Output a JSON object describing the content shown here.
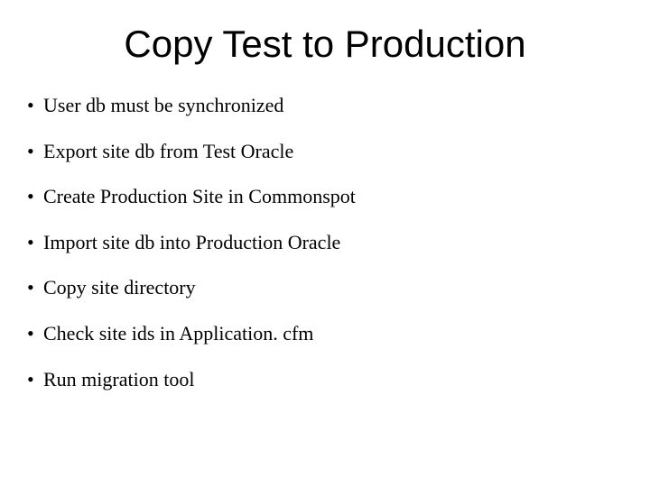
{
  "title": "Copy Test to Production",
  "bullets": [
    "User db must be synchronized",
    "Export site db from Test Oracle",
    "Create Production Site in Commonspot",
    "Import site db into Production Oracle",
    "Copy site directory",
    "Check site ids in Application. cfm",
    "Run migration tool"
  ]
}
